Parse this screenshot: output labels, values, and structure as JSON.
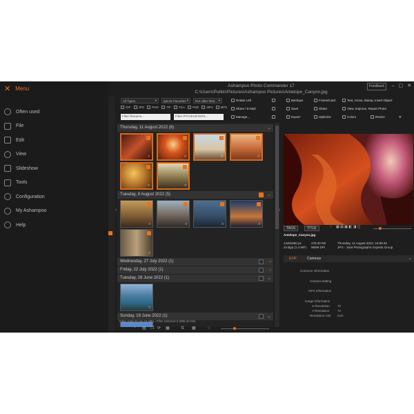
{
  "app": {
    "title": "Ashampoo Photo Commander 17",
    "path": "C:\\Users\\Public\\Pictures\\Ashampoo Pictures\\Antelope_Canyon.jpg",
    "feedback": "Feedback",
    "accent": "#e8731e"
  },
  "sidebar": {
    "menu_label": "Menu",
    "items": [
      {
        "label": "Often used",
        "icon": "clock-icon"
      },
      {
        "label": "File",
        "icon": "file-icon"
      },
      {
        "label": "Edit",
        "icon": "edit-icon"
      },
      {
        "label": "View",
        "icon": "eye-icon"
      },
      {
        "label": "Slideshow",
        "icon": "slideshow-icon"
      },
      {
        "label": "Tools",
        "icon": "tools-icon"
      },
      {
        "label": "Configuration",
        "icon": "gear-icon"
      },
      {
        "label": "My Ashampoo",
        "icon": "user-icon"
      },
      {
        "label": "Help",
        "icon": "help-icon"
      }
    ]
  },
  "filters": {
    "types_value": "All Types",
    "favorites_value": "Ignore Favorites",
    "date_value": "Not older than...",
    "file_types": [
      "GIF",
      "JPG",
      "PNG",
      "TIF",
      "TGA",
      "PSD",
      "MP4",
      "MP3"
    ],
    "filename_placeholder": "Filter filename...",
    "iptc_placeholder": "Filter IPTC/EXIF/GPS..."
  },
  "toolbar": {
    "rotate_left": "Rotate Left",
    "share_email": "Share / E-Mail",
    "manage": "Manage...",
    "backups": "Backups",
    "save": "Save",
    "export": "Export",
    "frame_card": "Frame/Card",
    "share": "Share",
    "optimize": "Optimize",
    "text_arrow": "Text, Arrow, Stamp, Insert Object",
    "view_improve": "View, Improve, Repair Photo",
    "colors": "Colors",
    "resize": "Resize"
  },
  "groups": [
    {
      "label": "Thursday, 11 August 2022 (6)"
    },
    {
      "label": "Tuesday, 9 August 2022 (5)"
    },
    {
      "label": "Wednesday, 27 July 2022 (1)"
    },
    {
      "label": "Friday, 22 July 2022 (1)"
    },
    {
      "label": "Tuesday, 28 June 2022 (1)"
    },
    {
      "label": "Sunday, 19 June 2022 (1)"
    }
  ],
  "status_text": "Files: total 21 (11.41 MB) - Files selected 6 (895.20 KB)",
  "preview_tabs": {
    "tags": "TAGS",
    "title": "TITLE"
  },
  "file_info": {
    "filename": "Antelope_Canyon.jpg",
    "dimensions": "1440x960 px",
    "size_kb": "278.30 KB",
    "bpp": "24 Bpp (1.4 MP)",
    "dpi": "96/96 DPI",
    "date": "Thursday, 11 August 2022, 15:58:46",
    "format": "JPG - Joint Photographic Experts Group"
  },
  "exif": {
    "tab_exif": "EXIF",
    "tab_common": "Common",
    "rows": [
      {
        "label": "Common Information",
        "value": ""
      },
      {
        "label": "Camera Setting",
        "value": ""
      },
      {
        "label": "GPS Information",
        "value": ""
      },
      {
        "label": "Image Information",
        "value": ""
      },
      {
        "label": "X-Resolution",
        "value": "72"
      },
      {
        "label": "Y-Resolution",
        "value": "72"
      },
      {
        "label": "Resolution Unit",
        "value": "Inch"
      }
    ]
  }
}
